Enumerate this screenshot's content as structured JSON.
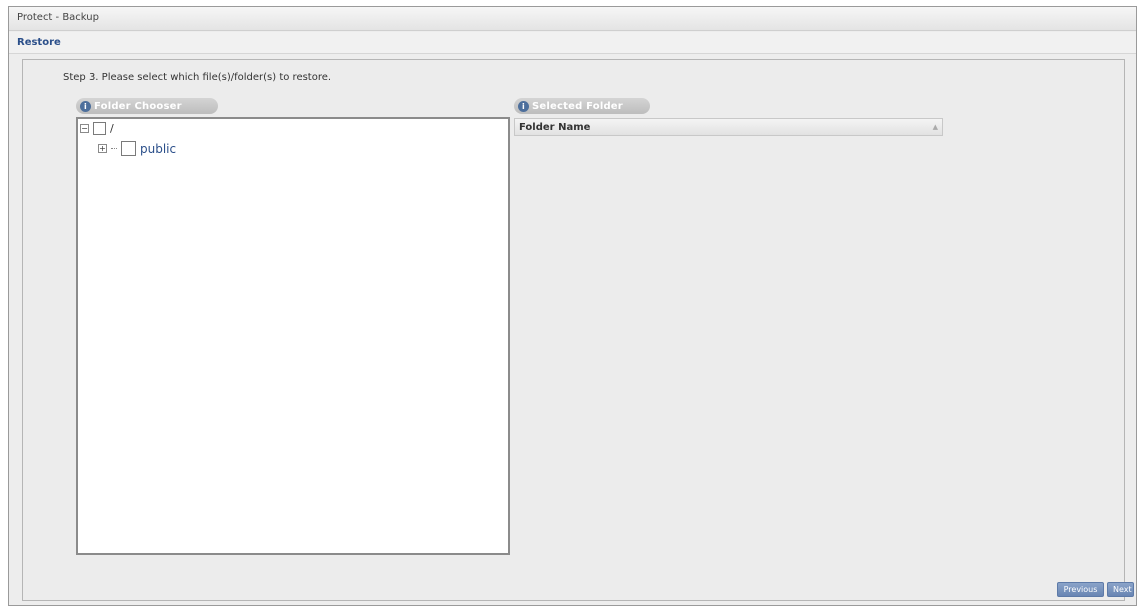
{
  "window": {
    "title": "Protect - Backup"
  },
  "subheader": {
    "label": "Restore"
  },
  "step": {
    "text": "Step 3. Please select which file(s)/folder(s) to restore."
  },
  "folder_chooser": {
    "label": "Folder Chooser",
    "tree": {
      "root": {
        "label": "/",
        "expander": "−",
        "checked": false
      },
      "children": [
        {
          "label": "public",
          "expander": "+",
          "checked": false
        }
      ]
    }
  },
  "selected_folder": {
    "label": "Selected Folder",
    "column_header": "Folder Name",
    "rows": []
  },
  "buttons": {
    "previous": "Previous",
    "next": "Next"
  },
  "colors": {
    "accent": "#2b4f8a",
    "button": "#6885b3",
    "panel_label": "#bdbdbd"
  },
  "icons": {
    "panel_label_icon": "info-icon",
    "sort_icon": "sort-arrow-icon"
  }
}
